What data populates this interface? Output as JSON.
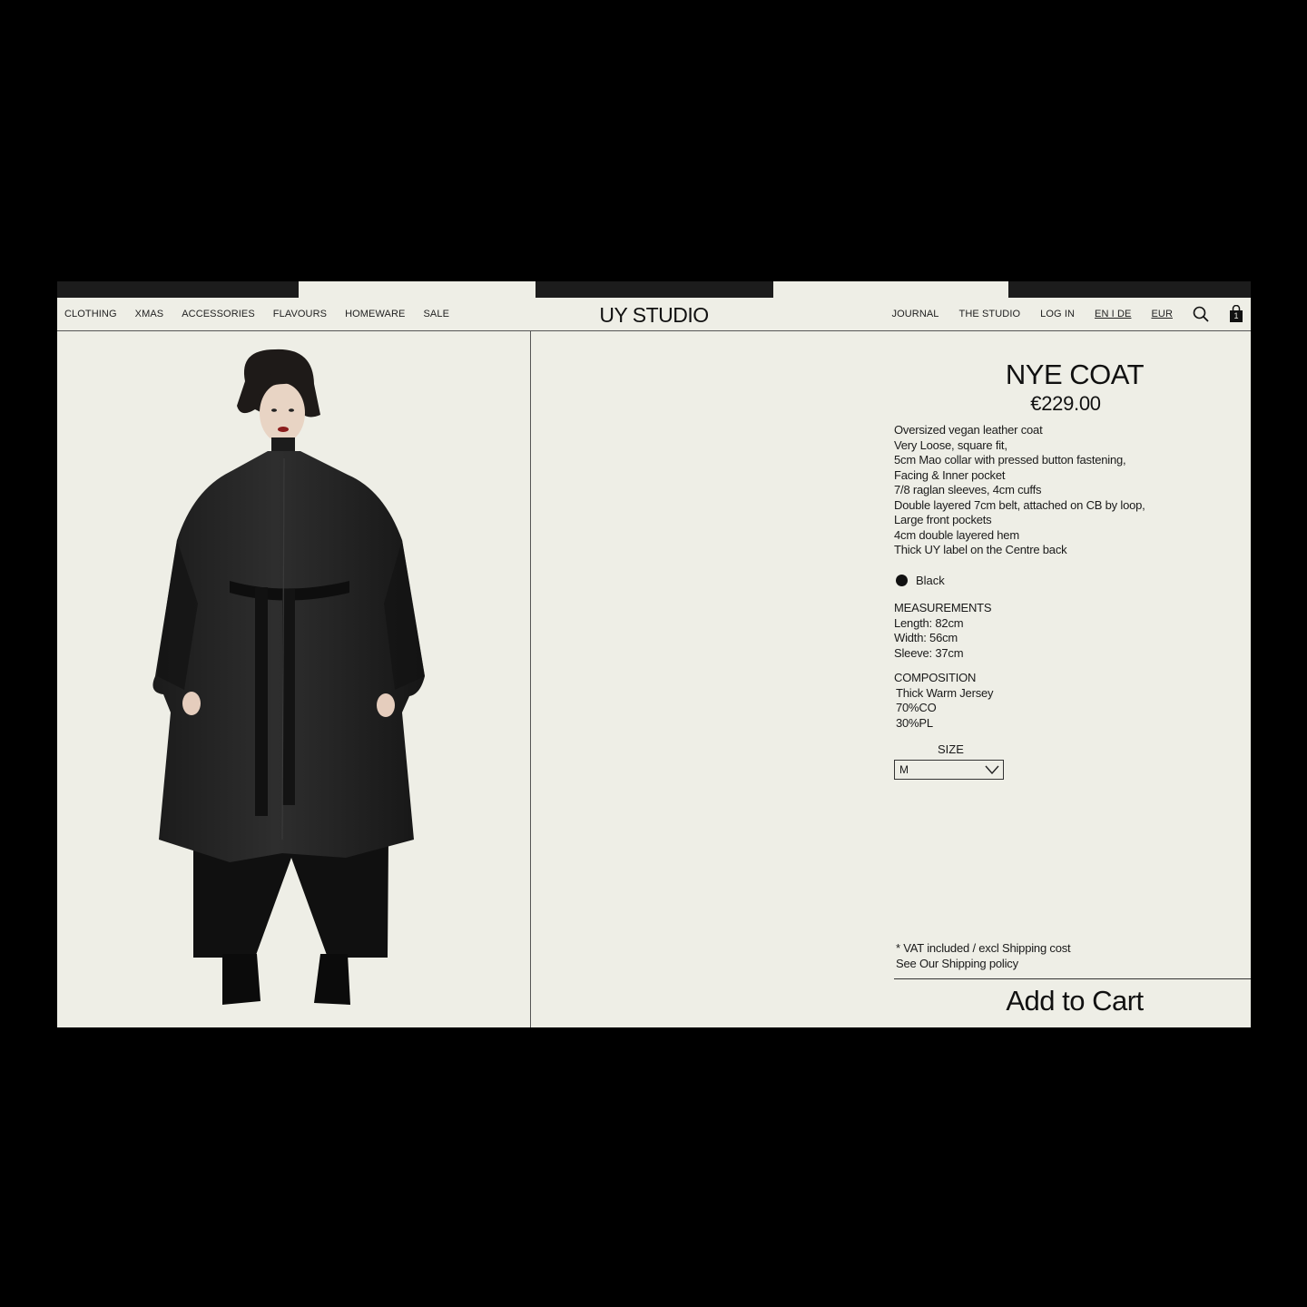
{
  "brand": {
    "logo": "UY STUDIO"
  },
  "nav": {
    "left": [
      "CLOTHING",
      "XMAS",
      "ACCESSORIES",
      "FLAVOURS",
      "HOMEWARE",
      "SALE"
    ],
    "right": {
      "journal": "JOURNAL",
      "studio": "THE STUDIO",
      "login": "LOG IN",
      "language": "EN I DE",
      "currency": "EUR"
    },
    "icons": {
      "search": "search-icon",
      "bag": "shopping-bag-icon"
    },
    "bag_count": "1"
  },
  "product": {
    "title": "NYE COAT",
    "price": "€229.00",
    "description": [
      "Oversized vegan leather coat",
      "Very Loose, square fit,",
      "5cm Mao collar with pressed button fastening,",
      "Facing & Inner pocket",
      "7/8 raglan sleeves, 4cm cuffs",
      "Double layered 7cm belt, attached on CB by loop,",
      "Large front pockets",
      "4cm double layered hem",
      "Thick UY label on the Centre back"
    ],
    "color": {
      "name": "Black",
      "swatch": "#111111"
    },
    "measurements": {
      "heading": "MEASUREMENTS",
      "lines": [
        "Length: 82cm",
        "Width: 56cm",
        "Sleeve: 37cm"
      ]
    },
    "composition": {
      "heading": "COMPOSITION",
      "lines": [
        "Thick Warm Jersey",
        "70%CO",
        "30%PL"
      ]
    },
    "size": {
      "label": "SIZE",
      "selected": "M"
    },
    "vat_note": "* VAT included / excl Shipping cost",
    "shipping_link": "See Our Shipping policy",
    "add_to_cart": "Add to Cart"
  },
  "colors": {
    "page_background": "#eeeee6",
    "frame": "#000000",
    "text": "#1a1a1a"
  }
}
